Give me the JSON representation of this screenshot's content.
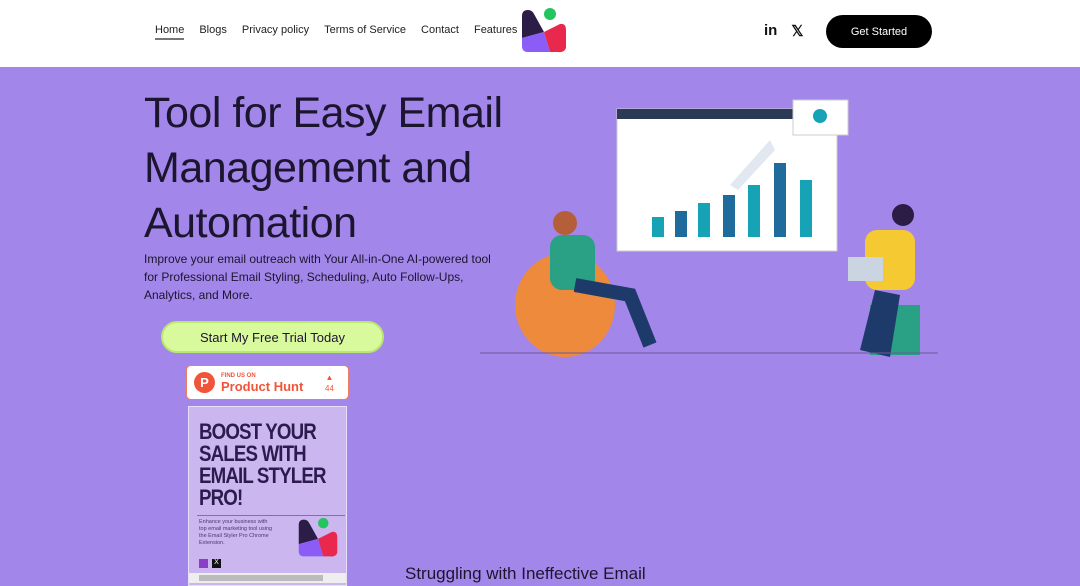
{
  "nav": {
    "items": [
      "Home",
      "Blogs",
      "Privacy policy",
      "Terms of Service",
      "Contact",
      "Features"
    ],
    "active": "Home"
  },
  "social": {
    "linkedin": "in",
    "x": "𝕏"
  },
  "header": {
    "cta": "Get Started"
  },
  "hero": {
    "title": "Tool for Easy Email Management and Automation",
    "subtitle": "Improve your email outreach with Your All-in-One AI-powered tool for Professional Email Styling, Scheduling, Auto Follow-Ups, Analytics, and More.",
    "cta": "Start My Free Trial Today"
  },
  "product_hunt": {
    "find_us": "FIND US ON",
    "name": "Product Hunt",
    "votes": "44"
  },
  "ad": {
    "title": "BOOST YOUR SALES WITH EMAIL STYLER PRO!",
    "desc": "Enhance your business with top email marketing tool using the Email Styler Pro Chrome Extension."
  },
  "section": {
    "heading": "Struggling with Ineffective Email"
  },
  "colors": {
    "background": "#a386ea",
    "cta_green": "#d9f99d",
    "product_hunt": "#f0553a"
  }
}
